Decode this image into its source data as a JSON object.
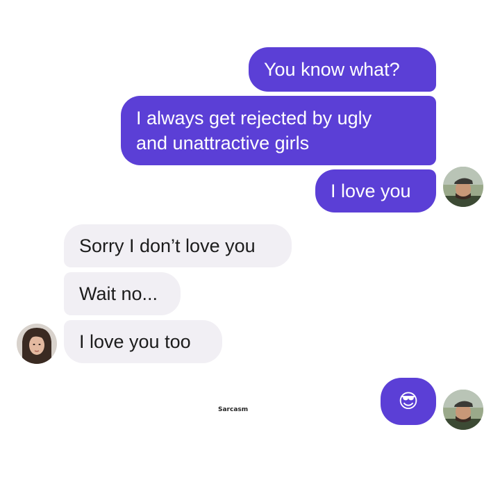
{
  "sent_messages": [
    {
      "text": "You know what?"
    },
    {
      "text_line1": "I always get rejected by ugly",
      "text_line2": "and unattractive girls"
    },
    {
      "text": "I love you"
    }
  ],
  "received_messages": [
    {
      "text": "Sorry I don’t love you"
    },
    {
      "text": "Wait no..."
    },
    {
      "text": "I love you too"
    }
  ],
  "final_sent": {
    "emoji": "😎",
    "emoji_name": "sunglasses-emoji"
  },
  "watermark": "Sarcasm",
  "colors": {
    "sent_bubble": "#5b3fd6",
    "received_bubble": "#f1eff4",
    "sent_text": "#ffffff",
    "received_text": "#1c1c1c"
  }
}
